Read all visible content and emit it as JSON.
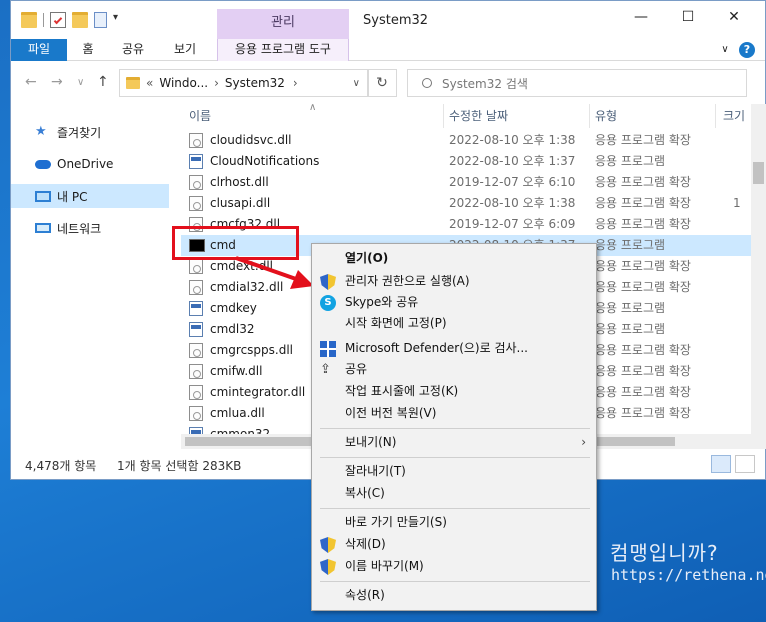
{
  "window": {
    "title": "System32",
    "context_tab_title": "관리",
    "controls": {
      "minimize": "—",
      "maximize": "☐",
      "close": "✕"
    }
  },
  "ribbon": {
    "tabs": [
      "파일",
      "홈",
      "공유",
      "보기"
    ],
    "app_tools": "응용 프로그램 도구",
    "expand": "∨",
    "help": "?"
  },
  "nav": {
    "back": "←",
    "forward": "→",
    "recent": "∨",
    "up": "↑",
    "address_prefix": "«",
    "path": [
      "Windo...",
      "System32"
    ],
    "sep": "›",
    "dropdown": "∨",
    "refresh": "↻",
    "search_placeholder": "System32 검색"
  },
  "sidebar": {
    "items": [
      {
        "label": "즐겨찾기"
      },
      {
        "label": "OneDrive"
      },
      {
        "label": "내 PC"
      },
      {
        "label": "네트워크"
      }
    ]
  },
  "columns": {
    "name": "이름",
    "date": "수정한 날짜",
    "type": "유형",
    "size": "크기"
  },
  "files": [
    {
      "name": "cloudidsvc.dll",
      "date": "2022-08-10 오후 1:38",
      "type": "응용 프로그램 확장",
      "size": ""
    },
    {
      "name": "CloudNotifications",
      "date": "2022-08-10 오후 1:37",
      "type": "응용 프로그램",
      "size": ""
    },
    {
      "name": "clrhost.dll",
      "date": "2019-12-07 오후 6:10",
      "type": "응용 프로그램 확장",
      "size": ""
    },
    {
      "name": "clusapi.dll",
      "date": "2022-08-10 오후 1:38",
      "type": "응용 프로그램 확장",
      "size": "1"
    },
    {
      "name": "cmcfg32.dll",
      "date": "2019-12-07 오후 6:09",
      "type": "응용 프로그램 확장",
      "size": ""
    },
    {
      "name": "cmd",
      "date": "2022-08-10 오후 1:37",
      "type": "응용 프로그램",
      "size": ""
    },
    {
      "name": "cmdext.dll",
      "date": "",
      "type": "응용 프로그램 확장",
      "size": ""
    },
    {
      "name": "cmdial32.dll",
      "date": "",
      "type": "응용 프로그램 확장",
      "size": ""
    },
    {
      "name": "cmdkey",
      "date": "",
      "type": "응용 프로그램",
      "size": ""
    },
    {
      "name": "cmdl32",
      "date": "",
      "type": "응용 프로그램",
      "size": ""
    },
    {
      "name": "cmgrcspps.dll",
      "date": "",
      "type": "응용 프로그램 확장",
      "size": ""
    },
    {
      "name": "cmifw.dll",
      "date": "",
      "type": "응용 프로그램 확장",
      "size": ""
    },
    {
      "name": "cmintegrator.dll",
      "date": "",
      "type": "응용 프로그램 확장",
      "size": ""
    },
    {
      "name": "cmlua.dll",
      "date": "",
      "type": "응용 프로그램 확장",
      "size": ""
    },
    {
      "name": "cmmon32",
      "date": "",
      "type": "",
      "size": ""
    }
  ],
  "status": {
    "count": "4,478개 항목",
    "selection": "1개 항목 선택함 283KB"
  },
  "context_menu": {
    "items": [
      {
        "label": "열기(O)"
      },
      {
        "label": "관리자 권한으로 실행(A)"
      },
      {
        "label": "Skype와 공유"
      },
      {
        "label": "시작 화면에 고정(P)"
      },
      {
        "label": "Microsoft Defender(으)로 검사..."
      },
      {
        "label": "공유"
      },
      {
        "label": "작업 표시줄에 고정(K)"
      },
      {
        "label": "이전 버전 복원(V)"
      },
      {
        "label": "보내기(N)"
      },
      {
        "label": "잘라내기(T)"
      },
      {
        "label": "복사(C)"
      },
      {
        "label": "바로 가기 만들기(S)"
      },
      {
        "label": "삭제(D)"
      },
      {
        "label": "이름 바꾸기(M)"
      },
      {
        "label": "속성(R)"
      }
    ],
    "submenu_arrow": "›",
    "skype_glyph": "S",
    "share_glyph": "⇪"
  },
  "watermark": {
    "title": "컴맹입니까?",
    "url": "https://rethena.net"
  },
  "colors": {
    "accent": "#1979ca",
    "selection": "#cce8ff",
    "annotation": "#e3101c",
    "context_tab": "#e3cff3"
  }
}
